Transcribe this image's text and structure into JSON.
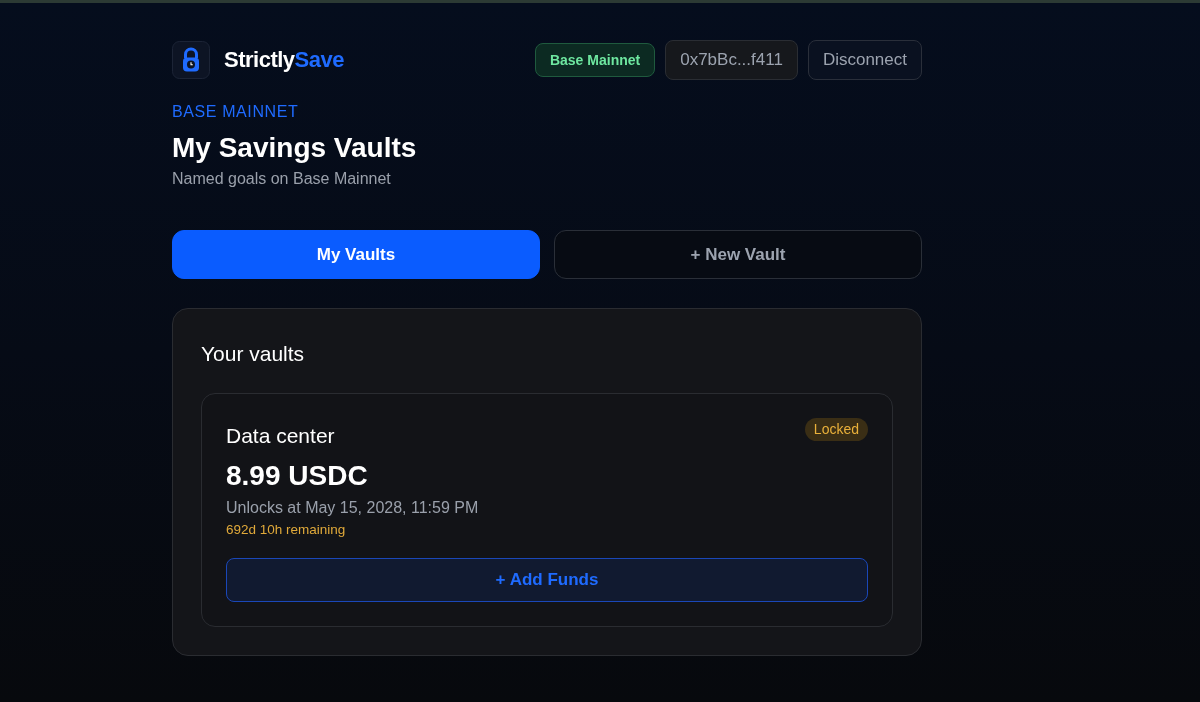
{
  "header": {
    "logo_text": [
      {
        "text": "Strictly",
        "kind": "plain"
      },
      {
        "text": "Save",
        "kind": "accent"
      }
    ],
    "network_badge": "Base Mainnet",
    "address": "0x7bBc...f411",
    "disconnect_button": "Disconnect"
  },
  "page": {
    "eyebrow": "BASE MAINNET",
    "title": "My Savings Vaults",
    "subtitle": "Named goals on Base Mainnet"
  },
  "tabs": [
    {
      "label": "My Vaults",
      "selected": true
    },
    {
      "label": "+ New Vault",
      "selected": false
    }
  ],
  "panel": {
    "title": "Your vaults",
    "vaults": [
      {
        "name": "Data center",
        "status": {
          "label": "Locked",
          "kind": "locked"
        },
        "amount": "8.99 USDC",
        "unlocks": "Unlocks at May 15, 2028, 11:59 PM",
        "remaining": "692d 10h remaining",
        "action": "+ Add Funds"
      }
    ]
  }
}
